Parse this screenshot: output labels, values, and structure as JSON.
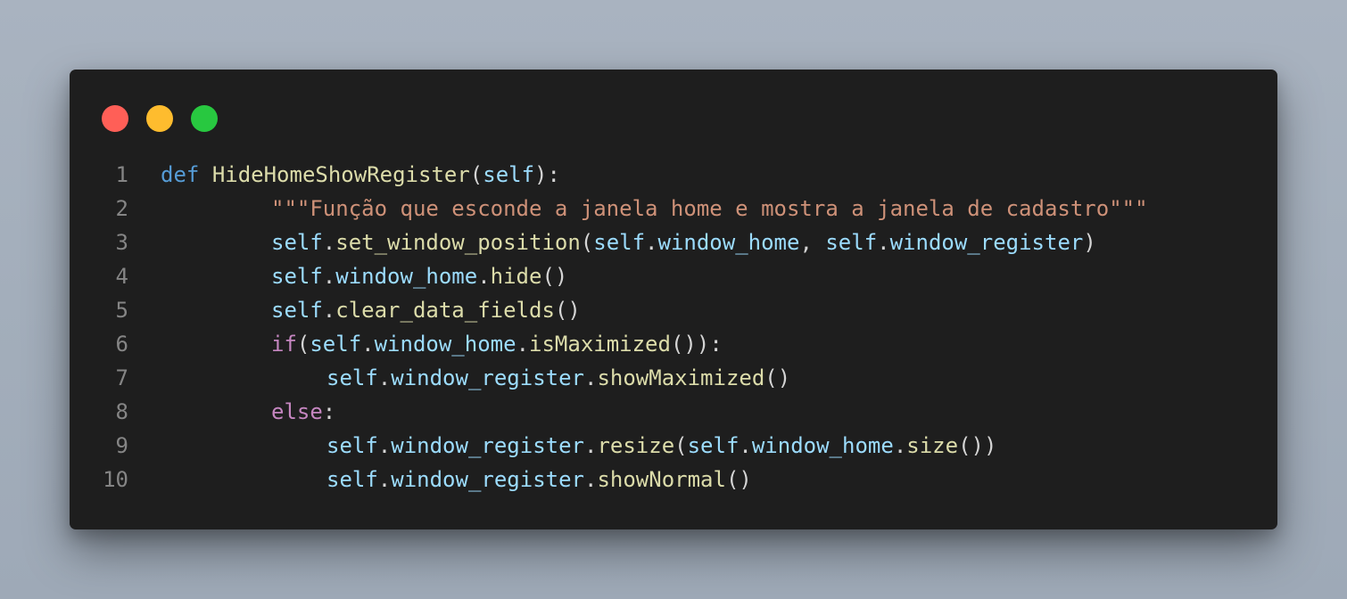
{
  "window": {
    "traffic_lights": [
      {
        "name": "close",
        "color": "#ff5f57"
      },
      {
        "name": "minimize",
        "color": "#febc2e"
      },
      {
        "name": "maximize",
        "color": "#28c840"
      }
    ]
  },
  "theme": {
    "keyword": "#569cd6",
    "control": "#c586c0",
    "function": "#dcdcaa",
    "variable": "#9cdcfe",
    "string": "#ce9178",
    "punctuation": "#d4d4d4",
    "line_number": "#858585",
    "background": "#1e1e1e"
  },
  "code": {
    "lines": [
      {
        "number": "1",
        "indent": 0,
        "tokens": [
          {
            "t": "def",
            "c": "k-def"
          },
          {
            "t": " ",
            "c": "punc"
          },
          {
            "t": "HideHomeShowRegister",
            "c": "fn"
          },
          {
            "t": "(",
            "c": "punc"
          },
          {
            "t": "self",
            "c": "var"
          },
          {
            "t": "):",
            "c": "punc"
          }
        ]
      },
      {
        "number": "2",
        "indent": 1,
        "tokens": [
          {
            "t": "\"\"\"Função que esconde a janela home e mostra a janela de cadastro\"\"\"",
            "c": "str"
          }
        ]
      },
      {
        "number": "3",
        "indent": 1,
        "tokens": [
          {
            "t": "self",
            "c": "var"
          },
          {
            "t": ".",
            "c": "punc"
          },
          {
            "t": "set_window_position",
            "c": "fn"
          },
          {
            "t": "(",
            "c": "punc"
          },
          {
            "t": "self",
            "c": "var"
          },
          {
            "t": ".",
            "c": "punc"
          },
          {
            "t": "window_home",
            "c": "var"
          },
          {
            "t": ", ",
            "c": "punc"
          },
          {
            "t": "self",
            "c": "var"
          },
          {
            "t": ".",
            "c": "punc"
          },
          {
            "t": "window_register",
            "c": "var"
          },
          {
            "t": ")",
            "c": "punc"
          }
        ]
      },
      {
        "number": "4",
        "indent": 1,
        "tokens": [
          {
            "t": "self",
            "c": "var"
          },
          {
            "t": ".",
            "c": "punc"
          },
          {
            "t": "window_home",
            "c": "var"
          },
          {
            "t": ".",
            "c": "punc"
          },
          {
            "t": "hide",
            "c": "fn"
          },
          {
            "t": "()",
            "c": "punc"
          }
        ]
      },
      {
        "number": "5",
        "indent": 1,
        "tokens": [
          {
            "t": "self",
            "c": "var"
          },
          {
            "t": ".",
            "c": "punc"
          },
          {
            "t": "clear_data_fields",
            "c": "fn"
          },
          {
            "t": "()",
            "c": "punc"
          }
        ]
      },
      {
        "number": "6",
        "indent": 1,
        "tokens": [
          {
            "t": "if",
            "c": "k-ctl"
          },
          {
            "t": "(",
            "c": "punc"
          },
          {
            "t": "self",
            "c": "var"
          },
          {
            "t": ".",
            "c": "punc"
          },
          {
            "t": "window_home",
            "c": "var"
          },
          {
            "t": ".",
            "c": "punc"
          },
          {
            "t": "isMaximized",
            "c": "fn"
          },
          {
            "t": "()):",
            "c": "punc"
          }
        ]
      },
      {
        "number": "7",
        "indent": 2,
        "tokens": [
          {
            "t": "self",
            "c": "var"
          },
          {
            "t": ".",
            "c": "punc"
          },
          {
            "t": "window_register",
            "c": "var"
          },
          {
            "t": ".",
            "c": "punc"
          },
          {
            "t": "showMaximized",
            "c": "fn"
          },
          {
            "t": "()",
            "c": "punc"
          }
        ]
      },
      {
        "number": "8",
        "indent": 1,
        "tokens": [
          {
            "t": "else",
            "c": "k-ctl"
          },
          {
            "t": ":",
            "c": "punc"
          }
        ]
      },
      {
        "number": "9",
        "indent": 2,
        "tokens": [
          {
            "t": "self",
            "c": "var"
          },
          {
            "t": ".",
            "c": "punc"
          },
          {
            "t": "window_register",
            "c": "var"
          },
          {
            "t": ".",
            "c": "punc"
          },
          {
            "t": "resize",
            "c": "fn"
          },
          {
            "t": "(",
            "c": "punc"
          },
          {
            "t": "self",
            "c": "var"
          },
          {
            "t": ".",
            "c": "punc"
          },
          {
            "t": "window_home",
            "c": "var"
          },
          {
            "t": ".",
            "c": "punc"
          },
          {
            "t": "size",
            "c": "fn"
          },
          {
            "t": "())",
            "c": "punc"
          }
        ]
      },
      {
        "number": "10",
        "indent": 2,
        "tokens": [
          {
            "t": "self",
            "c": "var"
          },
          {
            "t": ".",
            "c": "punc"
          },
          {
            "t": "window_register",
            "c": "var"
          },
          {
            "t": ".",
            "c": "punc"
          },
          {
            "t": "showNormal",
            "c": "fn"
          },
          {
            "t": "()",
            "c": "punc"
          }
        ]
      }
    ]
  }
}
